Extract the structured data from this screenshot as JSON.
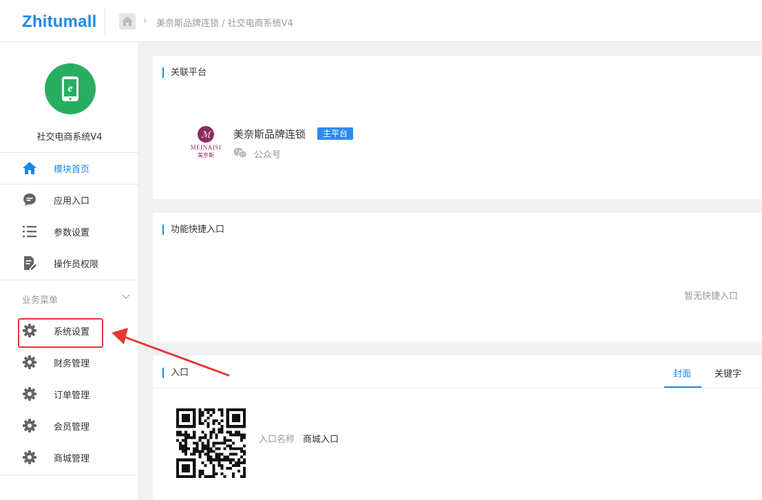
{
  "header": {
    "logo": "Zhitumall",
    "breadcrumb": "美奈斯品牌连锁 / 社交电商系统V4"
  },
  "sidebar": {
    "app_name": "社交电商系统V4",
    "main_items": [
      {
        "label": "模块首页",
        "icon": "home-icon"
      },
      {
        "label": "应用入口",
        "icon": "chat-bubble-icon"
      },
      {
        "label": "参数设置",
        "icon": "list-icon"
      },
      {
        "label": "操作员权限",
        "icon": "document-edit-icon"
      }
    ],
    "group_title": "业务菜单",
    "group_items": [
      {
        "label": "系统设置",
        "icon": "gear-icon"
      },
      {
        "label": "财务管理",
        "icon": "gear-icon"
      },
      {
        "label": "订单管理",
        "icon": "gear-icon"
      },
      {
        "label": "会员管理",
        "icon": "gear-icon"
      },
      {
        "label": "商城管理",
        "icon": "gear-icon"
      }
    ]
  },
  "linked_platform": {
    "title": "关联平台",
    "logo_text": "MEINAISI",
    "logo_sub": "美奈斯",
    "name": "美奈斯品牌连锁",
    "badge": "主平台",
    "type": "公众号"
  },
  "shortcuts": {
    "title": "功能快捷入口",
    "empty": "暂无快捷入口"
  },
  "entry": {
    "title": "入口",
    "tabs": [
      "封面",
      "关键字"
    ],
    "name_label": "入口名称",
    "name_value": "商城入口"
  },
  "colors": {
    "accent": "#1e88e5",
    "avatar": "#27ae60",
    "highlight": "#e53935",
    "badge": "#2d8cf0"
  }
}
